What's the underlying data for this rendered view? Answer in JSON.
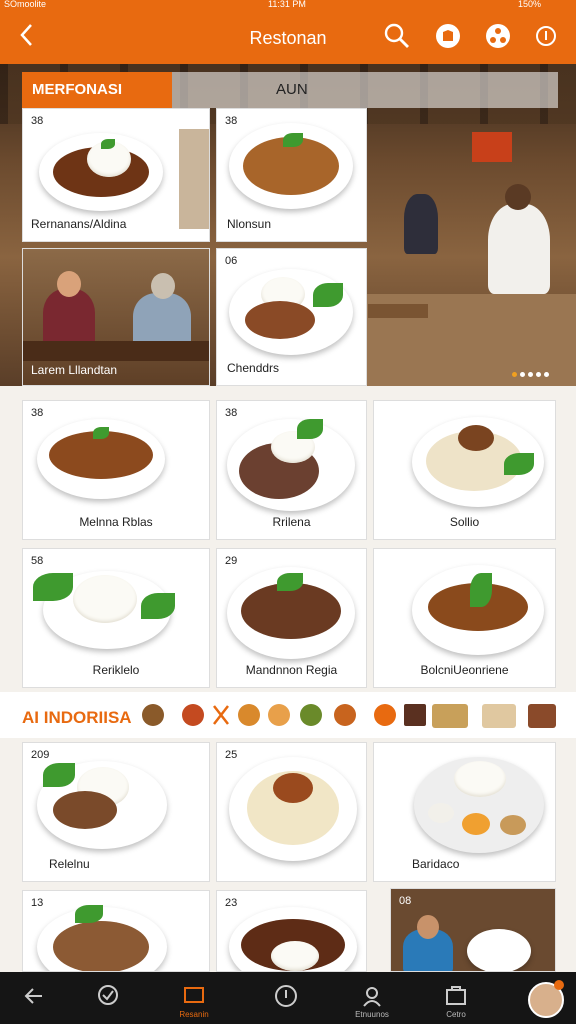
{
  "status_bar": {
    "carrier": "SOmoolite",
    "time": "11:31 PM",
    "battery": "150%"
  },
  "header": {
    "title": "Restonan"
  },
  "tabs": [
    {
      "label": "MERFONASI"
    },
    {
      "label": "AUN"
    }
  ],
  "hero_cards": [
    {
      "number": "38",
      "label": "Rernanans/Aldina"
    },
    {
      "number": "38",
      "label": "Nlonsun"
    },
    {
      "number": "",
      "label": "Larem Lllandtan"
    },
    {
      "number": "06",
      "label": "Chenddrs"
    }
  ],
  "menu_cards": [
    {
      "number": "38",
      "label": "Melnna Rblas"
    },
    {
      "number": "38",
      "label": "Rrilena"
    },
    {
      "number": "",
      "label": "Sollio"
    },
    {
      "number": "58",
      "label": "Reriklelo"
    },
    {
      "number": "29",
      "label": "Mandnnon Regia"
    },
    {
      "number": "",
      "label": "BolcniUeonriene"
    },
    {
      "number": "209",
      "label": "Relelnu"
    },
    {
      "number": "25",
      "label": ""
    },
    {
      "number": "",
      "label": "Baridaco"
    },
    {
      "number": "13",
      "label": ""
    },
    {
      "number": "23",
      "label": ""
    },
    {
      "number": "08",
      "label": ""
    }
  ],
  "category": {
    "title": "AI INDORIISA"
  },
  "bottom_nav": [
    {
      "label": ""
    },
    {
      "label": ""
    },
    {
      "label": "Resanin"
    },
    {
      "label": ""
    },
    {
      "label": "Etnuunos"
    },
    {
      "label": "Cetro"
    },
    {
      "label": ""
    }
  ],
  "colors": {
    "accent": "#e86a10",
    "nav_bg": "#151515"
  }
}
